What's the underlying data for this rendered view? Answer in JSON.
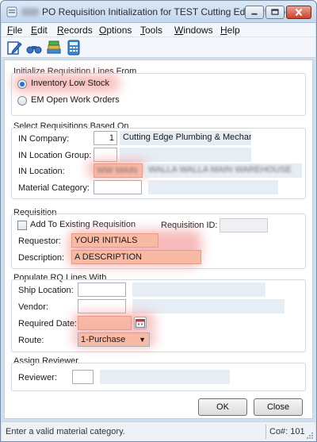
{
  "window": {
    "title_blurred": "XXX",
    "title": "PO Requisition Initialization for TEST Cutting Edge Plumb..."
  },
  "menu": {
    "items": [
      {
        "label": "File",
        "mnemonic": "F",
        "rest": "ile"
      },
      {
        "label": "Edit",
        "mnemonic": "E",
        "rest": "dit"
      },
      {
        "label": "Records",
        "mnemonic": "R",
        "rest": "ecords"
      },
      {
        "label": "Options",
        "mnemonic": "O",
        "rest": "ptions"
      },
      {
        "label": "Tools",
        "mnemonic": "T",
        "rest": "ools"
      },
      {
        "label": "Windows",
        "mnemonic": "W",
        "rest": "indows"
      },
      {
        "label": "Help",
        "mnemonic": "H",
        "rest": "elp"
      }
    ]
  },
  "toolbar": {
    "icons": [
      "edit-form-icon",
      "binoculars-icon",
      "stacked-books-icon",
      "calculator-icon"
    ]
  },
  "init_lines": {
    "title": "Initialize Requisition Lines From",
    "options": [
      {
        "label": "Inventory Low Stock",
        "checked": true
      },
      {
        "label": "EM Open Work Orders",
        "checked": false
      }
    ]
  },
  "select_based": {
    "title": "Select Requisitions Based On",
    "in_company_label": "IN Company:",
    "in_company_value": "1",
    "in_company_name": "Cutting Edge Plumbing & Mechanic...",
    "in_location_group_label": "IN Location Group:",
    "in_location_group_value": "",
    "in_location_label": "IN Location:",
    "in_location_value": "WW MAIN",
    "in_location_name": "WALLA WALLA MAIN WAREHOUSE",
    "material_category_label": "Material Category:",
    "material_category_value": ""
  },
  "requisition": {
    "title": "Requisition",
    "add_existing_label": "Add To Existing Requisition",
    "add_existing_checked": false,
    "requisition_id_label": "Requisition ID:",
    "requisition_id_value": "",
    "requestor_label": "Requestor:",
    "requestor_value": "YOUR INITIALS",
    "description_label": "Description:",
    "description_value": "A DESCRIPTION"
  },
  "populate": {
    "title": "Populate RQ Lines With",
    "ship_location_label": "Ship Location:",
    "ship_location_value": "",
    "vendor_label": "Vendor:",
    "vendor_value": "",
    "required_date_label": "Required Date:",
    "required_date_value": "",
    "route_label": "Route:",
    "route_value": "1-Purchase"
  },
  "reviewer": {
    "title": "Assign Reviewer",
    "reviewer_label": "Reviewer:",
    "reviewer_value": ""
  },
  "buttons": {
    "ok_label": "OK",
    "close_label": "Close"
  },
  "status": {
    "message": "Enter a valid material category.",
    "co_label": "Co#: 101"
  },
  "colors": {
    "highlight": "#f8b9a5",
    "display_bg": "#e6edf5"
  }
}
